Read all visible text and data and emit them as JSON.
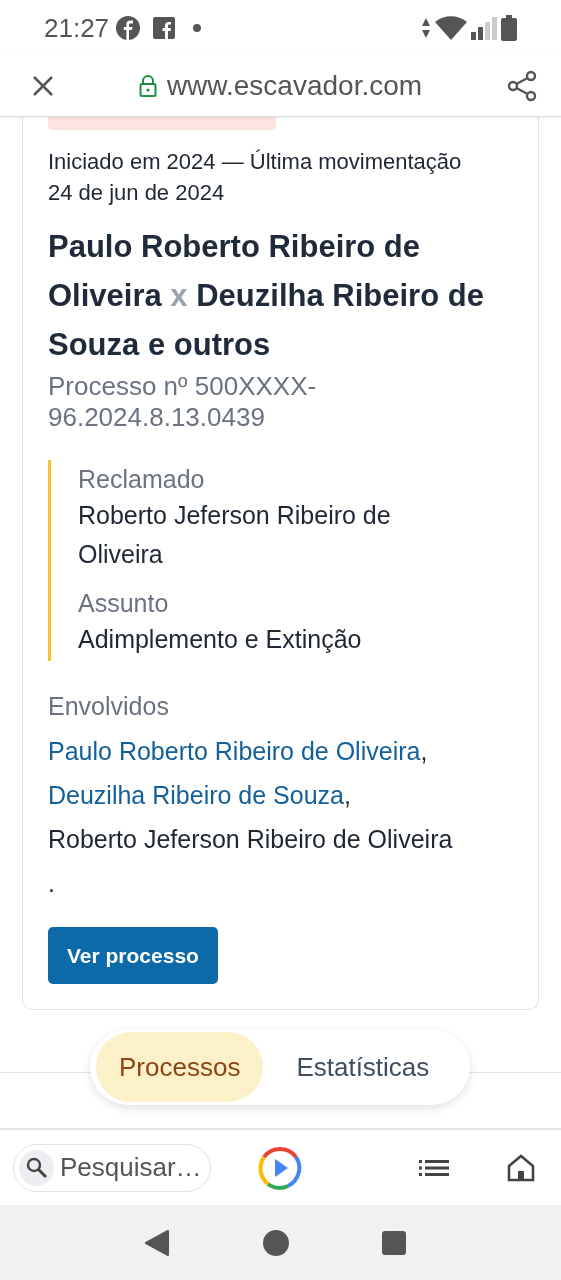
{
  "status_bar": {
    "time": "21:27"
  },
  "browser": {
    "url": "www.escavador.com"
  },
  "card": {
    "dates": "Iniciado em 2024 — Última movimentação 24 de jun de 2024",
    "title": {
      "left": "Paulo Roberto Ribeiro de Oliveira",
      "separator": "x",
      "right": "Deuzilha Ribeiro de Souza e outros"
    },
    "number": "Processo nº 500XXXX-96.2024.8.13.0439",
    "details": [
      {
        "label": "Reclamado",
        "value": "Roberto Jeferson Ribeiro de Oliveira"
      },
      {
        "label": "Assunto",
        "value": "Adimplemento e Extinção"
      }
    ],
    "involved": {
      "label": "Envolvidos",
      "parties": [
        {
          "name": "Paulo Roberto Ribeiro de Oliveira",
          "linked": true,
          "separator": ","
        },
        {
          "name": "Deuzilha Ribeiro de Souza",
          "linked": true,
          "separator": ","
        },
        {
          "name": "Roberto Jeferson Ribeiro de Oliveira",
          "linked": false
        }
      ],
      "terminator": "."
    },
    "button": "Ver processo"
  },
  "tabs": [
    {
      "label": "Processos",
      "selected": true
    },
    {
      "label": "Estatísticas",
      "selected": false
    }
  ],
  "bottom_bar": {
    "placeholder": "Pesquisar…"
  }
}
